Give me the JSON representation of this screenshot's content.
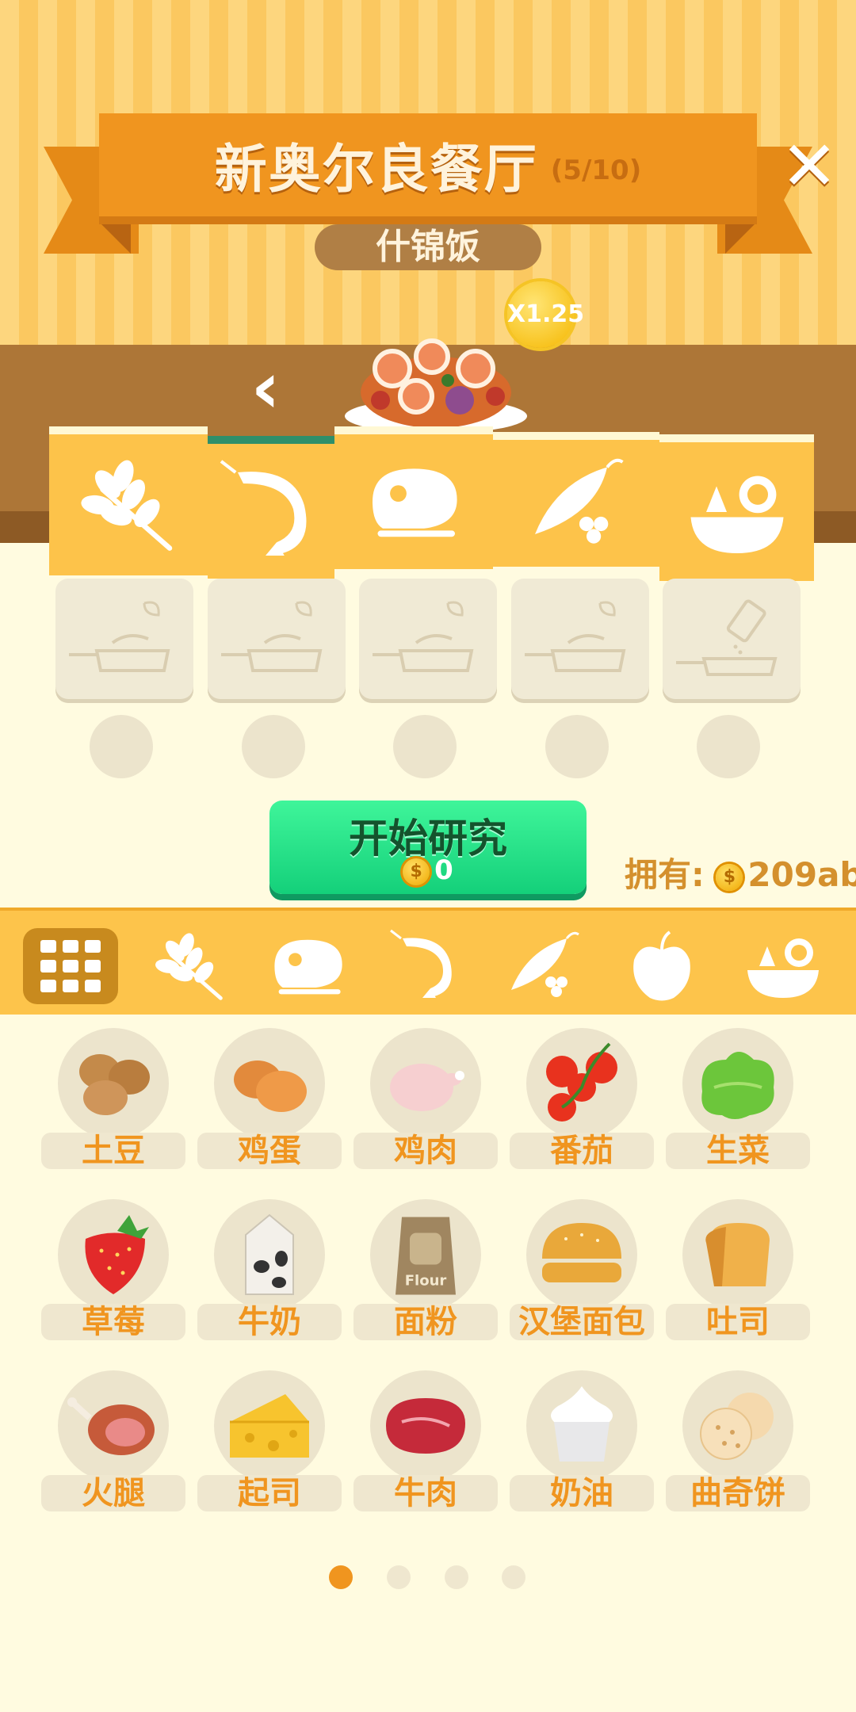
{
  "header": {
    "restaurant_name": "新奥尔良餐厅",
    "progress": "(5/10)",
    "dish_name": "什锦饭",
    "multiplier": "X1.25"
  },
  "icons": {
    "close": "close-icon",
    "prev": "chevron-left-icon",
    "grid": "grid-icon"
  },
  "recipe_categories": [
    "grain-icon",
    "shrimp-icon",
    "meat-icon",
    "pea-icon",
    "salad-icon"
  ],
  "research": {
    "button_label": "开始研究",
    "cost": "0",
    "owned_label": "拥有:",
    "owned_amount": "209ab"
  },
  "filter_tabs": [
    "grid-icon",
    "grain-icon",
    "meat-icon",
    "shrimp-icon",
    "pea-icon",
    "apple-icon",
    "salad-icon"
  ],
  "ingredients": [
    {
      "label": "土豆",
      "icon": "potato-icon"
    },
    {
      "label": "鸡蛋",
      "icon": "egg-icon"
    },
    {
      "label": "鸡肉",
      "icon": "chicken-icon"
    },
    {
      "label": "番茄",
      "icon": "tomato-icon"
    },
    {
      "label": "生菜",
      "icon": "lettuce-icon"
    },
    {
      "label": "草莓",
      "icon": "strawberry-icon"
    },
    {
      "label": "牛奶",
      "icon": "milk-icon"
    },
    {
      "label": "面粉",
      "icon": "flour-icon"
    },
    {
      "label": "汉堡面包",
      "icon": "burger-bun-icon"
    },
    {
      "label": "吐司",
      "icon": "toast-icon"
    },
    {
      "label": "火腿",
      "icon": "ham-icon"
    },
    {
      "label": "起司",
      "icon": "cheese-icon"
    },
    {
      "label": "牛肉",
      "icon": "beef-icon"
    },
    {
      "label": "奶油",
      "icon": "cream-icon"
    },
    {
      "label": "曲奇饼",
      "icon": "cookie-icon"
    }
  ],
  "flour_text": "Flour",
  "pagination": {
    "total": 4,
    "active": 1
  },
  "colors": {
    "accent": "#f0951f",
    "button": "#1fdc84",
    "panel": "#fdc34a"
  }
}
